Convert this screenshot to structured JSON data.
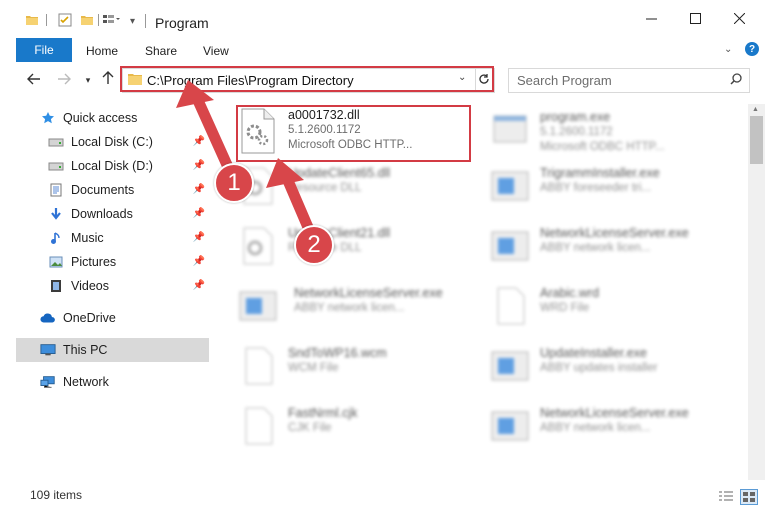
{
  "window": {
    "title": "Program",
    "minimize_icon": "minimize-icon",
    "maximize_icon": "maximize-icon",
    "close_icon": "close-icon"
  },
  "ribbon": {
    "tabs": [
      "File",
      "Home",
      "Share",
      "View"
    ],
    "help_icon": "help-icon"
  },
  "address": {
    "path": "C:\\Program Files\\Program Directory",
    "search_placeholder": "Search Program"
  },
  "sidebar": {
    "items": [
      {
        "label": "Quick access",
        "icon": "star-icon"
      },
      {
        "label": "Local Disk (C:)",
        "icon": "drive-icon",
        "pinned": true
      },
      {
        "label": "Local Disk (D:)",
        "icon": "drive-icon",
        "pinned": true
      },
      {
        "label": "Documents",
        "icon": "documents-icon",
        "pinned": true
      },
      {
        "label": "Downloads",
        "icon": "download-icon",
        "pinned": true
      },
      {
        "label": "Music",
        "icon": "music-icon",
        "pinned": true
      },
      {
        "label": "Pictures",
        "icon": "pictures-icon",
        "pinned": true
      },
      {
        "label": "Videos",
        "icon": "videos-icon",
        "pinned": true
      },
      {
        "label": "OneDrive",
        "icon": "cloud-icon"
      },
      {
        "label": "This PC",
        "icon": "computer-icon",
        "selected": true
      },
      {
        "label": "Network",
        "icon": "network-icon"
      }
    ]
  },
  "files": {
    "highlighted": {
      "name": "a0001732.dll",
      "version": "5.1.2600.1172",
      "description": "Microsoft ODBC HTTP..."
    },
    "others": [
      {
        "name": "program.exe",
        "line2": "5.1.2600.1172",
        "line3": "Microsoft ODBC HTTP..."
      },
      {
        "name": "UpdateClient65.dll",
        "line2": "Resource DLL"
      },
      {
        "name": "TrigrammInstaller.exe",
        "line2": "ABBY foreseeder tri..."
      },
      {
        "name": "UpdateClient21.dll",
        "line2": "Resource DLL"
      },
      {
        "name": "NetworkLicenseServer.exe",
        "line2": "ABBY network licen..."
      },
      {
        "name": "NetworkLicenseServer.exe",
        "line2": "ABBY network licen..."
      },
      {
        "name": "Arabic.wrd",
        "line2": "WRD File"
      },
      {
        "name": "SndToWP16.wcm",
        "line2": "WCM File"
      },
      {
        "name": "UpdateInstaller.exe",
        "line2": "ABBY updates installer"
      },
      {
        "name": "FastNrml.cjk",
        "line2": "CJK File"
      },
      {
        "name": "NetworkLicenseServer.exe",
        "line2": "ABBY network licen..."
      }
    ]
  },
  "status": {
    "item_count": "109 items"
  },
  "callouts": [
    "1",
    "2"
  ],
  "colors": {
    "accent": "#1979ca",
    "highlight": "#d33b44",
    "callout": "#d8464a"
  }
}
